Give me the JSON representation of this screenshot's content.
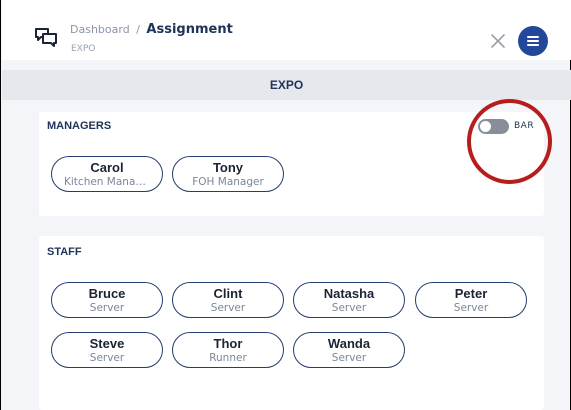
{
  "header": {
    "breadcrumb_parent": "Dashboard",
    "breadcrumb_separator": "/",
    "breadcrumb_current": "Assignment",
    "subtitle": "EXPO"
  },
  "section": {
    "title": "EXPO"
  },
  "managers": {
    "title": "MANAGERS",
    "toggle_label": "BAR",
    "toggle_on": false,
    "people": [
      {
        "name": "Carol",
        "role": "Kitchen Manager"
      },
      {
        "name": "Tony",
        "role": "FOH Manager"
      }
    ]
  },
  "staff": {
    "title": "STAFF",
    "people": [
      {
        "name": "Bruce",
        "role": "Server"
      },
      {
        "name": "Clint",
        "role": "Server"
      },
      {
        "name": "Natasha",
        "role": "Server"
      },
      {
        "name": "Peter",
        "role": "Server"
      },
      {
        "name": "Steve",
        "role": "Server"
      },
      {
        "name": "Thor",
        "role": "Runner"
      },
      {
        "name": "Wanda",
        "role": "Server"
      }
    ]
  },
  "colors": {
    "accent": "#23489a",
    "pill_border": "#233d6e",
    "annotation": "#b81d1d"
  },
  "icons": {
    "logo": "chat-bubbles-icon",
    "close": "close-icon",
    "menu": "hamburger-icon"
  }
}
